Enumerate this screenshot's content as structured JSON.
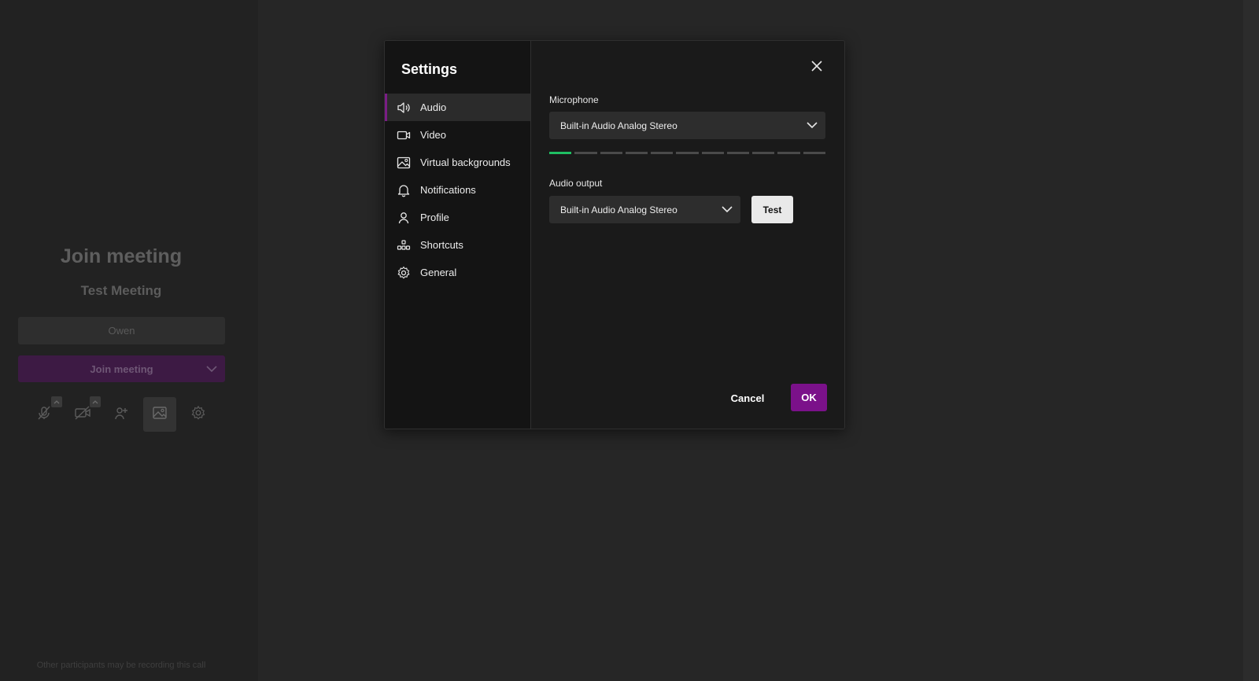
{
  "background": {
    "title": "Join meeting",
    "meeting_name": "Test Meeting",
    "name_placeholder": "Owen",
    "join_button_label": "Join meeting",
    "footer_note": "Other participants may be recording this call",
    "toolbar_icons": [
      "microphone-off-icon",
      "camera-off-icon",
      "add-person-icon",
      "image-icon",
      "gear-icon"
    ]
  },
  "dialog": {
    "title": "Settings",
    "nav": [
      {
        "label": "Audio",
        "icon": "speaker-icon",
        "selected": true
      },
      {
        "label": "Video",
        "icon": "video-camera-icon",
        "selected": false
      },
      {
        "label": "Virtual backgrounds",
        "icon": "image-icon",
        "selected": false
      },
      {
        "label": "Notifications",
        "icon": "bell-icon",
        "selected": false
      },
      {
        "label": "Profile",
        "icon": "person-icon",
        "selected": false
      },
      {
        "label": "Shortcuts",
        "icon": "shortcuts-icon",
        "selected": false
      },
      {
        "label": "General",
        "icon": "gear-icon",
        "selected": false
      }
    ],
    "microphone": {
      "label": "Microphone",
      "value": "Built-in Audio Analog Stereo",
      "level_segments_total": 11,
      "level_segments_active": 1
    },
    "audio_output": {
      "label": "Audio output",
      "value": "Built-in Audio Analog Stereo",
      "test_label": "Test"
    },
    "cancel_label": "Cancel",
    "ok_label": "OK"
  },
  "colors": {
    "accent": "#7b118a",
    "meter_active": "#1fbf63",
    "dialog_bg": "#1a1a1a",
    "page_bg": "#262626"
  }
}
